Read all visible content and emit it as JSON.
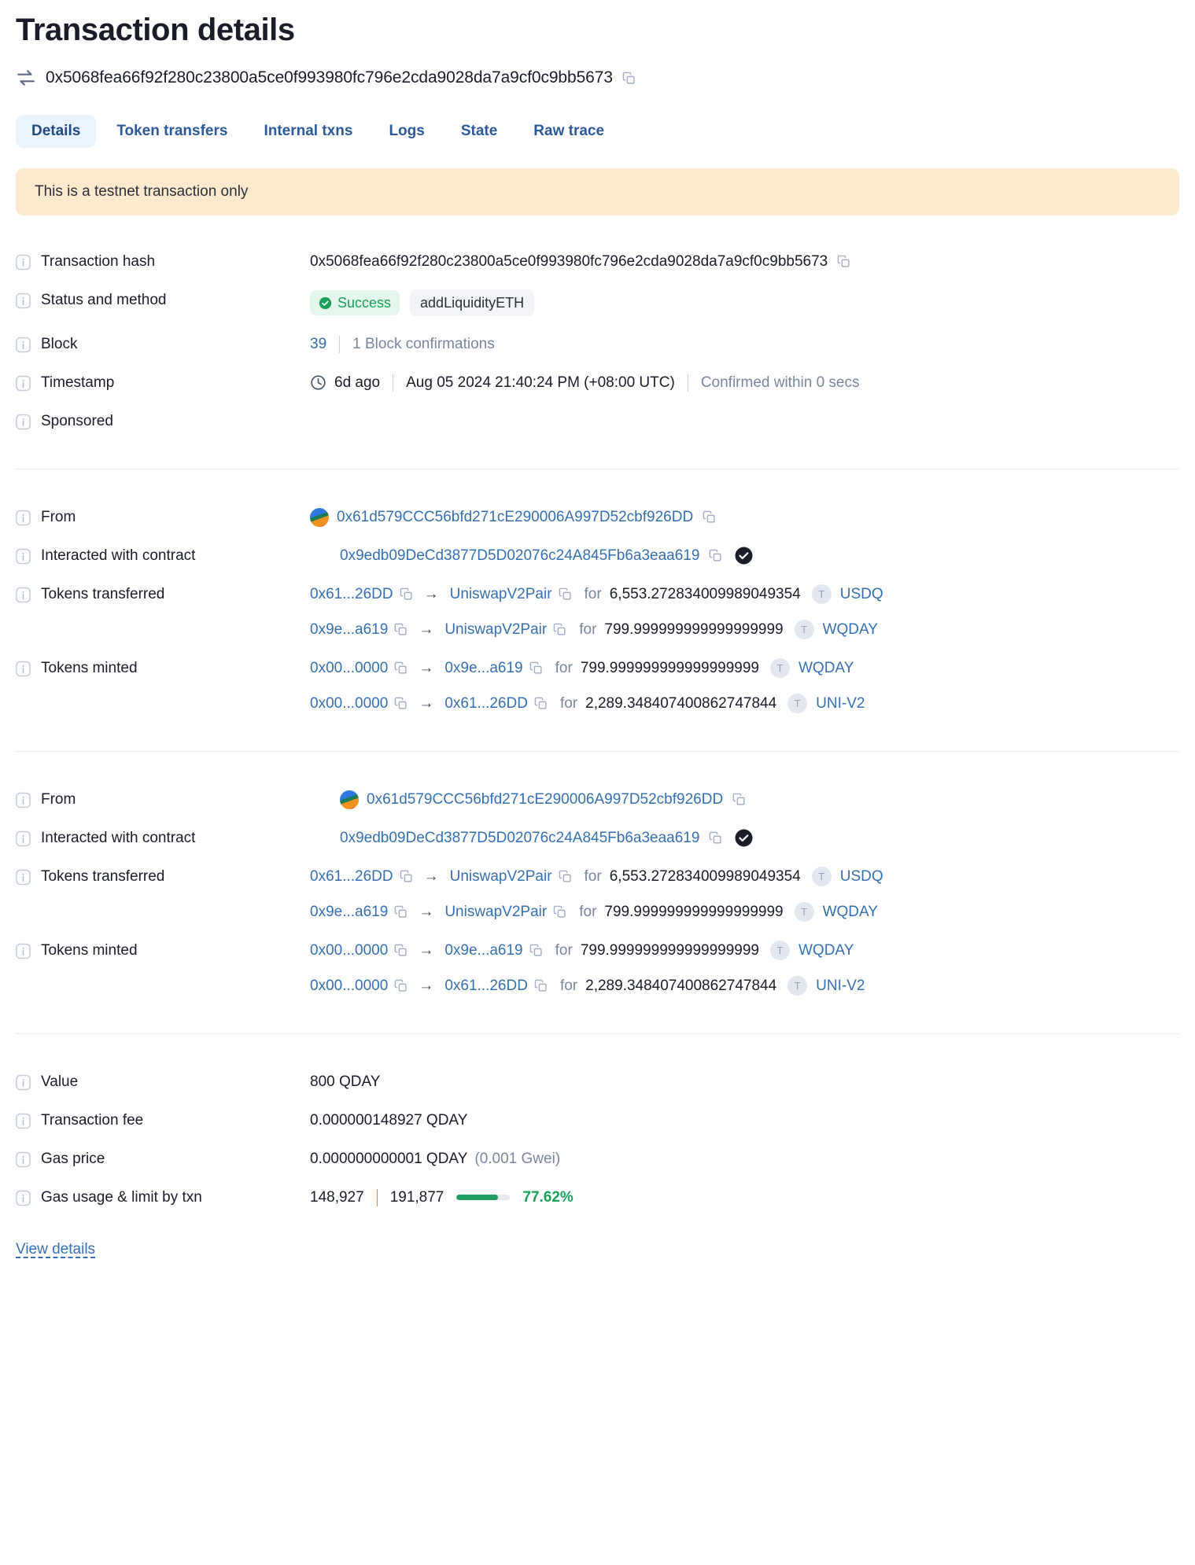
{
  "header": {
    "title": "Transaction details",
    "hash": "0x5068fea66f92f280c23800a5ce0f993980fc796e2cda9028da7a9cf0c9bb5673"
  },
  "tabs": [
    {
      "label": "Details",
      "active": true
    },
    {
      "label": "Token transfers",
      "active": false
    },
    {
      "label": "Internal txns",
      "active": false
    },
    {
      "label": "Logs",
      "active": false
    },
    {
      "label": "State",
      "active": false
    },
    {
      "label": "Raw trace",
      "active": false
    }
  ],
  "banner": {
    "text": "This is a testnet transaction only",
    "bg_color": "#fdeacd"
  },
  "labels": {
    "transaction_hash": "Transaction hash",
    "status_and_method": "Status and method",
    "block": "Block",
    "timestamp": "Timestamp",
    "sponsored": "Sponsored",
    "from": "From",
    "interacted_with_contract": "Interacted with contract",
    "tokens_transferred": "Tokens transferred",
    "tokens_minted": "Tokens minted",
    "value": "Value",
    "transaction_fee": "Transaction fee",
    "gas_price": "Gas price",
    "gas_usage_limit": "Gas usage & limit by txn"
  },
  "details": {
    "transaction_hash": "0x5068fea66f92f280c23800a5ce0f993980fc796e2cda9028da7a9cf0c9bb5673",
    "status": "Success",
    "status_color": "#19a05a",
    "method": "addLiquidityETH",
    "block_number": "39",
    "block_confirmations": "1 Block confirmations",
    "time_ago": "6d ago",
    "timestamp_full": "Aug 05 2024 21:40:24 PM (+08:00 UTC)",
    "confirmed_within": "Confirmed within 0 secs",
    "value": "800 QDAY",
    "transaction_fee": "0.000000148927 QDAY",
    "gas_price": "0.000000000001 QDAY",
    "gas_price_gwei": "(0.001 Gwei)",
    "gas_used": "148,927",
    "gas_limit": "191,877",
    "gas_percent": "77.62%",
    "gas_percent_value": 77.62
  },
  "sections": [
    {
      "from_address": "0x61d579CCC56bfd271cE290006A997D52cbf926DD",
      "contract_address": "0x9edb09DeCd3877D5D02076c24A845Fb6a3eaa619",
      "tokens_transferred": [
        {
          "from": "0x61...26DD",
          "to": "UniswapV2Pair",
          "for_label": "for",
          "amount": "6,553.272834009989049354",
          "token_badge": "T",
          "token_symbol": "USDQ"
        },
        {
          "from": "0x9e...a619",
          "to": "UniswapV2Pair",
          "for_label": "for",
          "amount": "799.999999999999999999",
          "token_badge": "T",
          "token_symbol": "WQDAY"
        }
      ],
      "tokens_minted": [
        {
          "from": "0x00...0000",
          "to": "0x9e...a619",
          "for_label": "for",
          "amount": "799.999999999999999999",
          "token_badge": "T",
          "token_symbol": "WQDAY"
        },
        {
          "from": "0x00...0000",
          "to": "0x61...26DD",
          "for_label": "for",
          "amount": "2,289.348407400862747844",
          "token_badge": "T",
          "token_symbol": "UNI-V2"
        }
      ]
    },
    {
      "from_address": "0x61d579CCC56bfd271cE290006A997D52cbf926DD",
      "contract_address": "0x9edb09DeCd3877D5D02076c24A845Fb6a3eaa619",
      "tokens_transferred": [
        {
          "from": "0x61...26DD",
          "to": "UniswapV2Pair",
          "for_label": "for",
          "amount": "6,553.272834009989049354",
          "token_badge": "T",
          "token_symbol": "USDQ"
        },
        {
          "from": "0x9e...a619",
          "to": "UniswapV2Pair",
          "for_label": "for",
          "amount": "799.999999999999999999",
          "token_badge": "T",
          "token_symbol": "WQDAY"
        }
      ],
      "tokens_minted": [
        {
          "from": "0x00...0000",
          "to": "0x9e...a619",
          "for_label": "for",
          "amount": "799.999999999999999999",
          "token_badge": "T",
          "token_symbol": "WQDAY"
        },
        {
          "from": "0x00...0000",
          "to": "0x61...26DD",
          "for_label": "for",
          "amount": "2,289.348407400862747844",
          "token_badge": "T",
          "token_symbol": "UNI-V2"
        }
      ]
    }
  ],
  "footer": {
    "view_details": "View details"
  },
  "icons": {
    "swap": "swap-arrows-icon",
    "copy": "copy-icon",
    "info": "info-icon",
    "clock": "clock-icon",
    "check": "check-circle-icon",
    "verified": "verified-contract-icon",
    "arrow": "→"
  }
}
